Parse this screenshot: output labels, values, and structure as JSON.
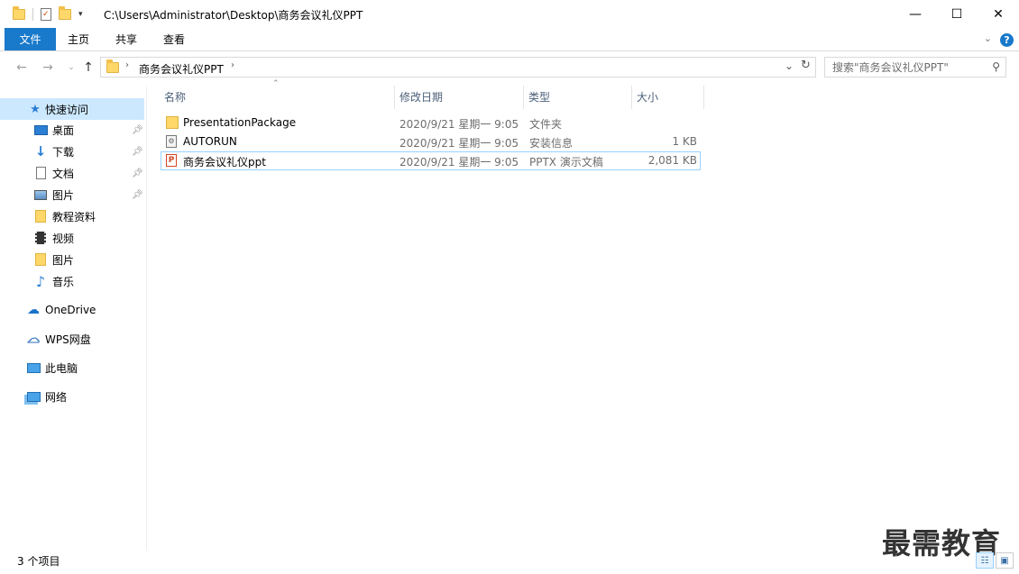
{
  "window": {
    "title_path": "C:\\Users\\Administrator\\Desktop\\商务会议礼仪PPT",
    "minimize": "—",
    "maximize": "☐",
    "close": "✕"
  },
  "ribbon": {
    "tabs": [
      "文件",
      "主页",
      "共享",
      "查看"
    ],
    "help": "?"
  },
  "address": {
    "breadcrumb": "商务会议礼仪PPT",
    "search_placeholder": "搜索\"商务会议礼仪PPT\""
  },
  "sidebar": {
    "items": [
      {
        "label": "快速访问",
        "icon": "star-icon"
      },
      {
        "label": "桌面",
        "icon": "desktop-icon"
      },
      {
        "label": "下载",
        "icon": "download-icon"
      },
      {
        "label": "文档",
        "icon": "document-icon"
      },
      {
        "label": "图片",
        "icon": "pictures-icon"
      },
      {
        "label": "教程资料",
        "icon": "folder-icon"
      },
      {
        "label": "视频",
        "icon": "video-icon"
      },
      {
        "label": "图片",
        "icon": "folder-icon"
      },
      {
        "label": "音乐",
        "icon": "music-icon"
      },
      {
        "label": "OneDrive",
        "icon": "cloud-icon"
      },
      {
        "label": "WPS网盘",
        "icon": "wps-cloud-icon"
      },
      {
        "label": "此电脑",
        "icon": "computer-icon"
      },
      {
        "label": "网络",
        "icon": "network-icon"
      }
    ]
  },
  "columns": {
    "name": "名称",
    "date": "修改日期",
    "type": "类型",
    "size": "大小"
  },
  "files": [
    {
      "name": "PresentationPackage",
      "date": "2020/9/21 星期一 9:05",
      "type": "文件夹",
      "size": "",
      "icon": "folder-icon"
    },
    {
      "name": "AUTORUN",
      "date": "2020/9/21 星期一 9:05",
      "type": "安装信息",
      "size": "1 KB",
      "icon": "settings-file-icon"
    },
    {
      "name": "商务会议礼仪ppt",
      "date": "2020/9/21 星期一 9:05",
      "type": "PPTX 演示文稿",
      "size": "2,081 KB",
      "icon": "pptx-file-icon"
    }
  ],
  "status": {
    "count": "3 个项目"
  },
  "watermark": "最需教育"
}
